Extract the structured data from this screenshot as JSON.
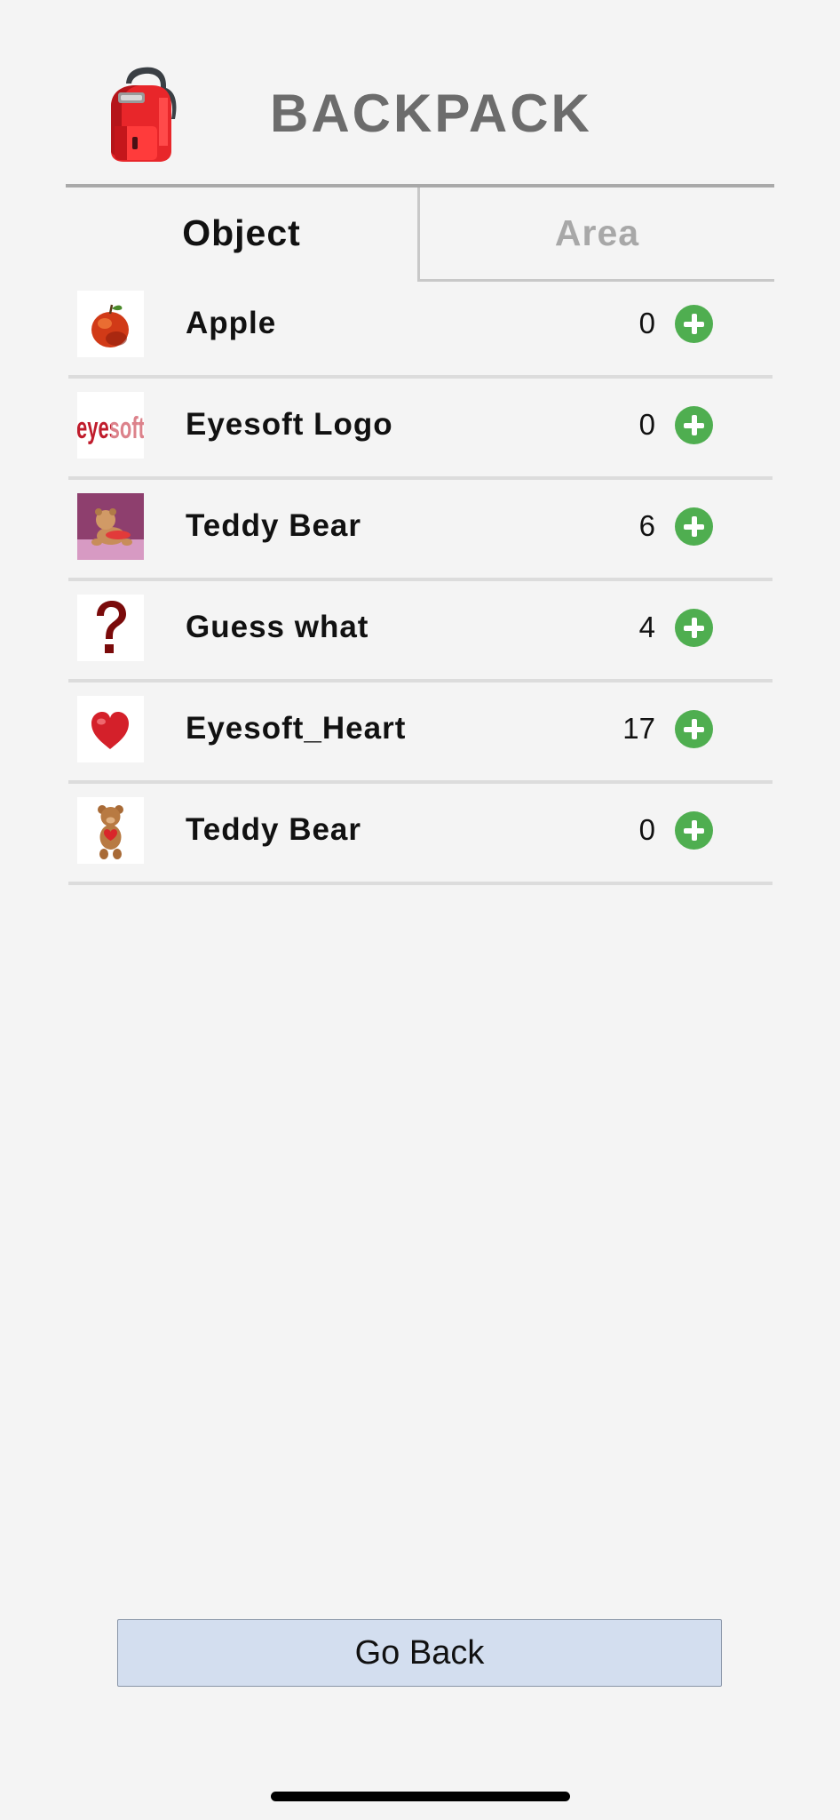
{
  "header": {
    "title": "BACKPACK",
    "icon": "backpack-icon"
  },
  "tabs": [
    {
      "label": "Object",
      "active": true
    },
    {
      "label": "Area",
      "active": false
    }
  ],
  "items": [
    {
      "name": "Apple",
      "count": "0",
      "icon": "apple-thumbnail"
    },
    {
      "name": "Eyesoft Logo",
      "count": "0",
      "icon": "eyesoft-logo-thumbnail",
      "thumb_text": "eyesoft"
    },
    {
      "name": "Teddy Bear",
      "count": "6",
      "icon": "teddy-bear-photo-thumbnail"
    },
    {
      "name": "Guess what",
      "count": "4",
      "icon": "question-mark-thumbnail"
    },
    {
      "name": "Eyesoft_Heart",
      "count": "17",
      "icon": "heart-thumbnail"
    },
    {
      "name": "Teddy Bear",
      "count": "0",
      "icon": "teddy-bear-thumbnail"
    }
  ],
  "footer": {
    "go_back_label": "Go Back"
  },
  "colors": {
    "background": "#f4f4f4",
    "title": "#6c6c6c",
    "add_button": "#4fae50",
    "go_back_button": "#d3deef",
    "active_tab_text": "#111111",
    "inactive_tab_text": "#a8a8a8"
  }
}
